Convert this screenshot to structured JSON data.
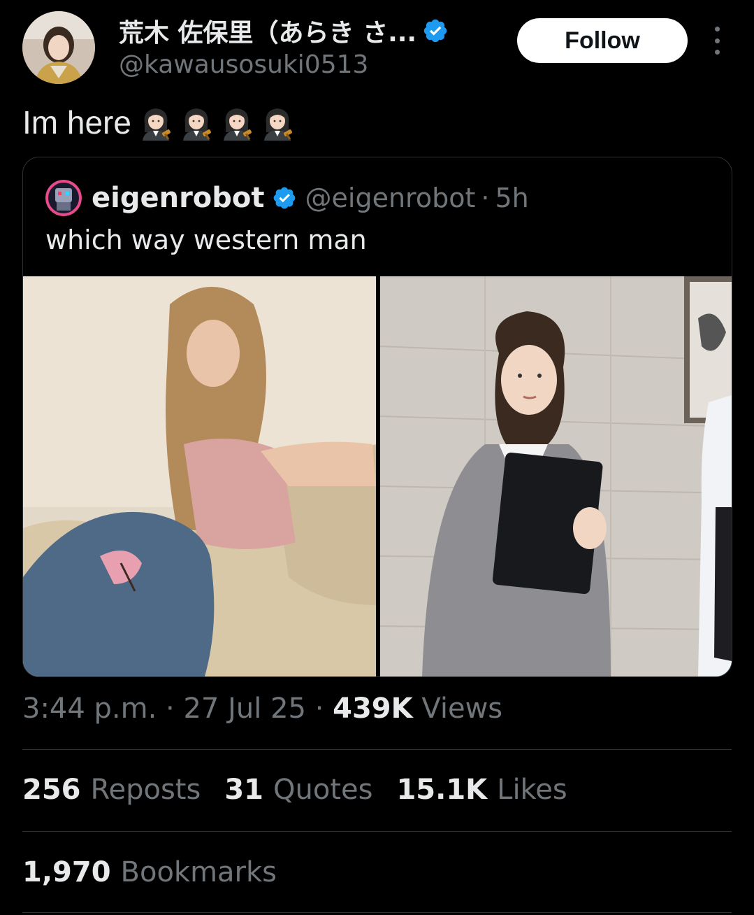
{
  "author": {
    "display_name": "荒木 佐保里（あらき さ...",
    "handle": "@kawausosuki0513",
    "verified_icon": "verified-badge-icon"
  },
  "follow_label": "Follow",
  "tweet": {
    "text": "Im here",
    "emoji": [
      "judge-emoji",
      "judge-emoji",
      "judge-emoji",
      "judge-emoji"
    ]
  },
  "quoted": {
    "name": "eigenrobot",
    "handle": "@eigenrobot",
    "separator": "·",
    "time": "5h",
    "text": "which way western man"
  },
  "meta": {
    "time": "3:44 p.m.",
    "sep1": "·",
    "date": "27 Jul 25",
    "sep2": "·",
    "views_count": "439K",
    "views_label": "Views"
  },
  "stats": {
    "reposts_count": "256",
    "reposts_label": "Reposts",
    "quotes_count": "31",
    "quotes_label": "Quotes",
    "likes_count": "15.1K",
    "likes_label": "Likes",
    "bookmarks_count": "1,970",
    "bookmarks_label": "Bookmarks"
  },
  "colors": {
    "background": "#000000",
    "text": "#e7e9ea",
    "muted": "#71767b",
    "verified": "#1d9bf0",
    "border": "#2f3336"
  }
}
